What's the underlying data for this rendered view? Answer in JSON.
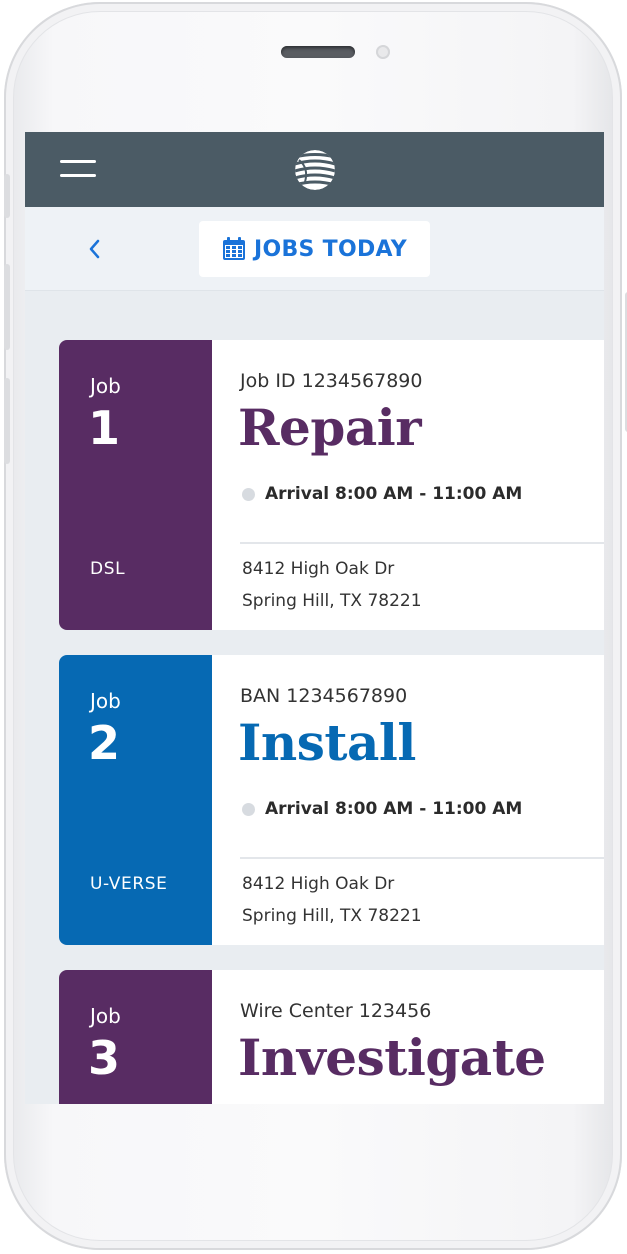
{
  "colors": {
    "topbar": "#4b5b65",
    "accent_blue": "#1a73d9",
    "purple": "#582c63",
    "blue": "#0669b3"
  },
  "header": {
    "menu_icon": "hamburger-menu-icon",
    "logo_icon": "att-globe-logo-icon"
  },
  "subheader": {
    "back_icon": "chevron-left-icon",
    "calendar_icon": "calendar-icon",
    "title": "JOBS TODAY"
  },
  "jobs": [
    {
      "word": "Job",
      "number": "1",
      "service": "DSL",
      "id_line": "Job ID 1234567890",
      "type": "Repair",
      "arrival": "Arrival 8:00 AM - 11:00 AM",
      "address_line1": "8412 High Oak Dr",
      "address_line2": "Spring Hill, TX 78221",
      "color": "#582c63"
    },
    {
      "word": "Job",
      "number": "2",
      "service": "U-VERSE",
      "id_line": "BAN 1234567890",
      "type": "Install",
      "arrival": "Arrival 8:00 AM - 11:00 AM",
      "address_line1": "8412 High Oak Dr",
      "address_line2": "Spring Hill, TX 78221",
      "color": "#0669b3"
    },
    {
      "word": "Job",
      "number": "3",
      "id_line": "Wire Center 123456",
      "type": "Investigate",
      "color": "#582c63"
    }
  ]
}
